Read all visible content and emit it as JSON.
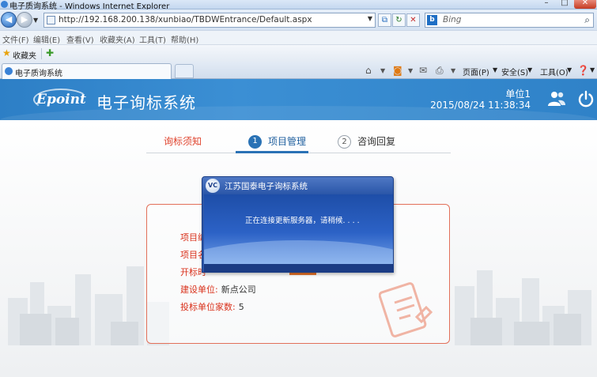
{
  "browser": {
    "window_title": "电子质询系统 - Windows Internet Explorer",
    "url": "http://192.168.200.138/xunbiao/TBDWEntrance/Default.aspx",
    "search_placeholder": "Bing",
    "menu": [
      "文件(F)",
      "编辑(E)",
      "查看(V)",
      "收藏夹(A)",
      "工具(T)",
      "帮助(H)"
    ],
    "favorites_label": "收藏夹",
    "tab_title": "电子质询系统",
    "commands": {
      "page": "页面(P)",
      "safety": "安全(S)",
      "tools": "工具(O)"
    }
  },
  "app": {
    "logo_text": "Epoint",
    "title": "电子询标系统",
    "unit": "单位1",
    "datetime": "2015/08/24 11:38:34",
    "header_color": "#2d7fc6"
  },
  "steps": [
    {
      "label": "询标须知",
      "state": "normal"
    },
    {
      "number": "1",
      "label": "项目管理",
      "state": "active"
    },
    {
      "number": "2",
      "label": "咨询回复",
      "state": "normal"
    }
  ],
  "project": {
    "builder_label": "建设单位:",
    "builder_value": "新点公司",
    "bidder_count_label": "投标单位家数:",
    "bidder_count_value": "5"
  },
  "dialog": {
    "logo": "VC",
    "title": "江苏国泰电子询标系统",
    "message": "正在连接更新服务器，请稍候. . . ."
  },
  "colors": {
    "accent_red": "#e0442e",
    "active_blue": "#2a72b5",
    "card_border": "#e2705a",
    "dialog_blue": "#2b56a8"
  }
}
